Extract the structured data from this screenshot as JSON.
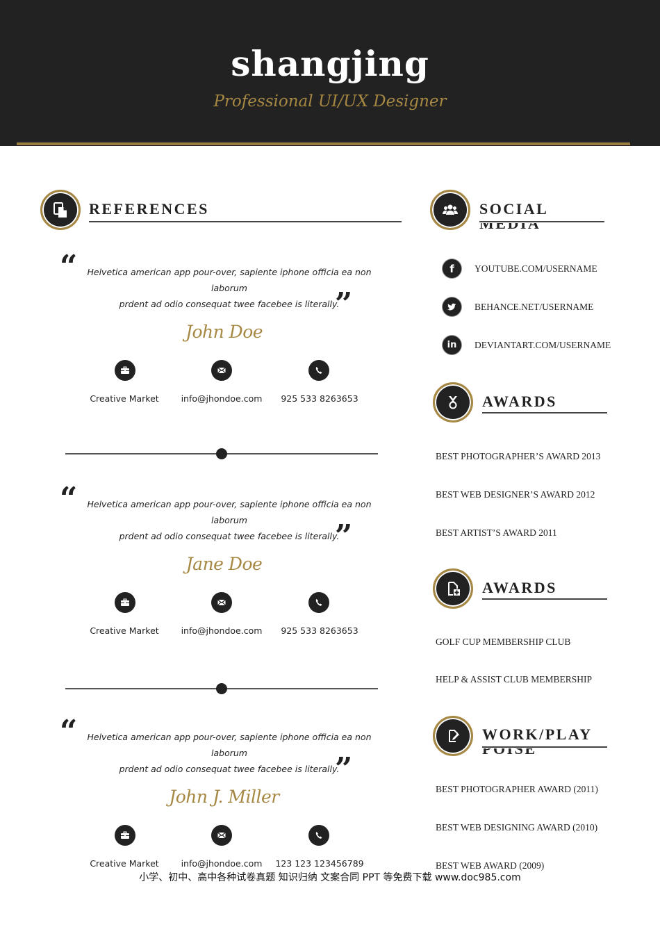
{
  "header": {
    "name": "shangjing",
    "role": "Professional UI/UX Designer"
  },
  "colors": {
    "dark": "#222222",
    "gold": "#a68843"
  },
  "references": {
    "title": "REFERENCES",
    "icon": "documents-icon",
    "items": [
      {
        "quote_line1": "Helvetica american app  pour-over, sapiente iphone officia ea non laborum",
        "quote_line2": "prdent ad odio consequat twee facebee is literally.",
        "name": "John Doe",
        "company": "Creative Market",
        "email": "info@jhondoe.com",
        "phone": "925 533 8263653"
      },
      {
        "quote_line1": "Helvetica american app  pour-over, sapiente iphone officia ea non laborum",
        "quote_line2": "prdent ad odio consequat twee facebee is literally.",
        "name": "Jane Doe",
        "company": "Creative Market",
        "email": "info@jhondoe.com",
        "phone": "925 533 8263653"
      },
      {
        "quote_line1": "Helvetica american app  pour-over, sapiente iphone officia ea non laborum",
        "quote_line2": "prdent ad odio consequat twee facebee is literally.",
        "name": "John J. Miller",
        "company": "Creative Market",
        "email": "info@jhondoe.com",
        "phone": "123 123 123456789"
      }
    ],
    "quote_open": "“",
    "quote_close": "”"
  },
  "social": {
    "title": "SOCIAL",
    "title_overflow": "MEDIA",
    "icon": "users-icon",
    "items": [
      {
        "icon": "facebook-icon",
        "glyph": "f",
        "label": "YOUTUBE.COM/USERNAME"
      },
      {
        "icon": "twitter-icon",
        "glyph": "t",
        "label": "BEHANCE.NET/USERNAME"
      },
      {
        "icon": "linkedin-icon",
        "glyph": "in",
        "label": "DEVIANTART.COM/USERNAME"
      }
    ]
  },
  "awards": {
    "title": "AWARDS",
    "icon": "medal-icon",
    "items": [
      "BEST PHOTOGRAPHER’S AWARD 2013",
      "BEST WEB DESIGNER’S AWARD 2012",
      "BEST ARTIST’S AWARD 2011"
    ]
  },
  "memberships": {
    "title": "AWARDS",
    "icon": "document-plus-icon",
    "items": [
      "GOLF CUP MEMBERSHIP CLUB",
      "HELP & ASSIST CLUB MEMBERSHIP"
    ]
  },
  "workplay": {
    "title": "WORK/PLAY",
    "title_overflow": "POISE",
    "icon": "edit-document-icon",
    "items": [
      "BEST PHOTOGRAPHER AWARD (2011)",
      "BEST WEB DESIGNING AWARD (2010)",
      "BEST WEB AWARD (2009)"
    ]
  },
  "footer": {
    "note": "小学、初中、高中各种试卷真题 知识归纳 文案合同 PPT 等免费下载   www.doc985.com"
  }
}
